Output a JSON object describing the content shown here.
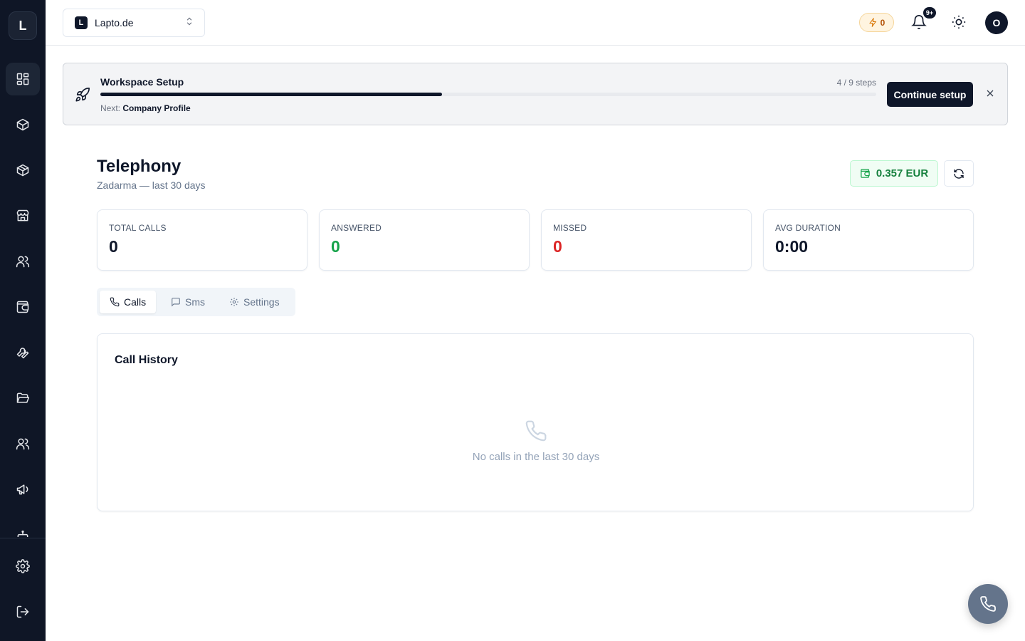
{
  "sidebar": {
    "logo_letter": "L",
    "items": [
      {
        "name": "dashboard",
        "active": true
      },
      {
        "name": "products",
        "active": false
      },
      {
        "name": "inventory",
        "active": false
      },
      {
        "name": "store",
        "active": false
      },
      {
        "name": "contacts",
        "active": false
      },
      {
        "name": "wallet",
        "active": false
      },
      {
        "name": "tools",
        "active": false
      },
      {
        "name": "files",
        "active": false
      },
      {
        "name": "team",
        "active": false
      },
      {
        "name": "marketing",
        "active": false
      }
    ]
  },
  "topbar": {
    "workspace": {
      "badge": "L",
      "name": "Lapto.de"
    },
    "credits": "0",
    "notifications_badge": "9+",
    "avatar_letter": "O"
  },
  "setup": {
    "title": "Workspace Setup",
    "steps": "4 / 9 steps",
    "progress": 0.44,
    "next_label": "Next:",
    "next_value": "Company Profile",
    "continue_label": "Continue setup"
  },
  "page": {
    "title": "Telephony",
    "subtitle": "Zadarma — last 30 days",
    "balance": "0.357 EUR"
  },
  "stats": [
    {
      "label": "TOTAL CALLS",
      "value": "0"
    },
    {
      "label": "ANSWERED",
      "value": "0"
    },
    {
      "label": "MISSED",
      "value": "0"
    },
    {
      "label": "AVG DURATION",
      "value": "0:00"
    }
  ],
  "tabs": [
    {
      "label": "Calls",
      "active": true
    },
    {
      "label": "Sms",
      "active": false
    },
    {
      "label": "Settings",
      "active": false
    }
  ],
  "call_history": {
    "title": "Call History",
    "empty_text": "No calls in the last 30 days"
  },
  "colors": {
    "sidebar_bg": "#0f1626",
    "primary": "#0f172a",
    "answered": "#16a34a",
    "missed": "#dc2626",
    "balance": "#15803d",
    "credits": "#b45309",
    "fab": "#64748b"
  }
}
